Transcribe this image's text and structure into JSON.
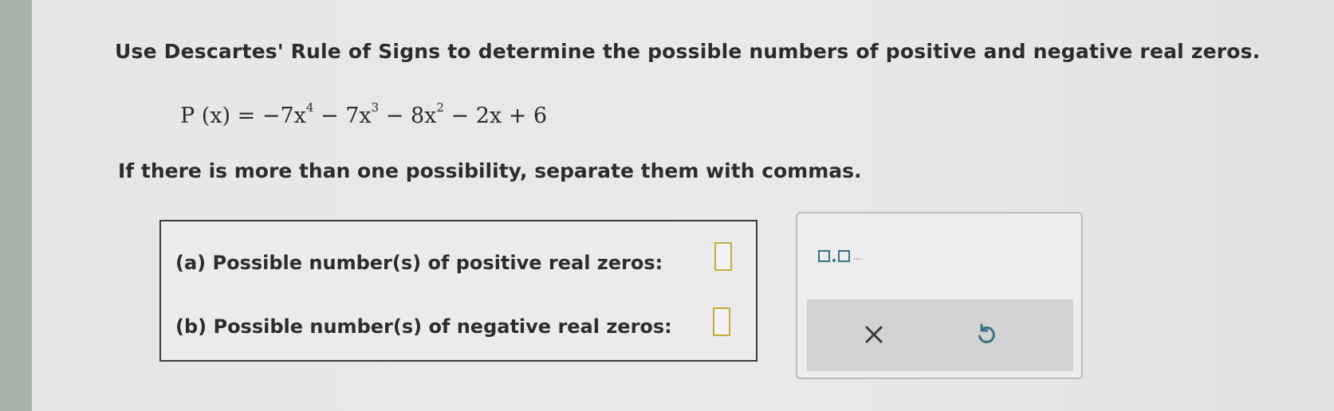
{
  "question": {
    "instruction": "Use Descartes' Rule of Signs to determine the possible numbers of positive and negative real zeros.",
    "equation": {
      "lhs": "P (x) = ",
      "terms": [
        {
          "text": "−7x",
          "exp": "4"
        },
        {
          "text": " − 7x",
          "exp": "3"
        },
        {
          "text": " − 8x",
          "exp": "2"
        },
        {
          "text": " − 2x + 6",
          "exp": ""
        }
      ]
    },
    "note": "If there is more than one possibility, separate them with commas."
  },
  "answers": {
    "positive_label": "(a)  Possible number(s) of positive real zeros:",
    "positive_value": "",
    "negative_label": "(b)  Possible number(s) of negative real zeros:",
    "negative_value": ""
  },
  "tools": {
    "multi_answer_icon": "multiple-answer-icon",
    "multi_answer_dots": "...",
    "clear_icon": "clear-x-icon",
    "undo_icon": "undo-icon",
    "accent_color": "#3d6f86",
    "input_border_color": "#c2ad3c"
  }
}
